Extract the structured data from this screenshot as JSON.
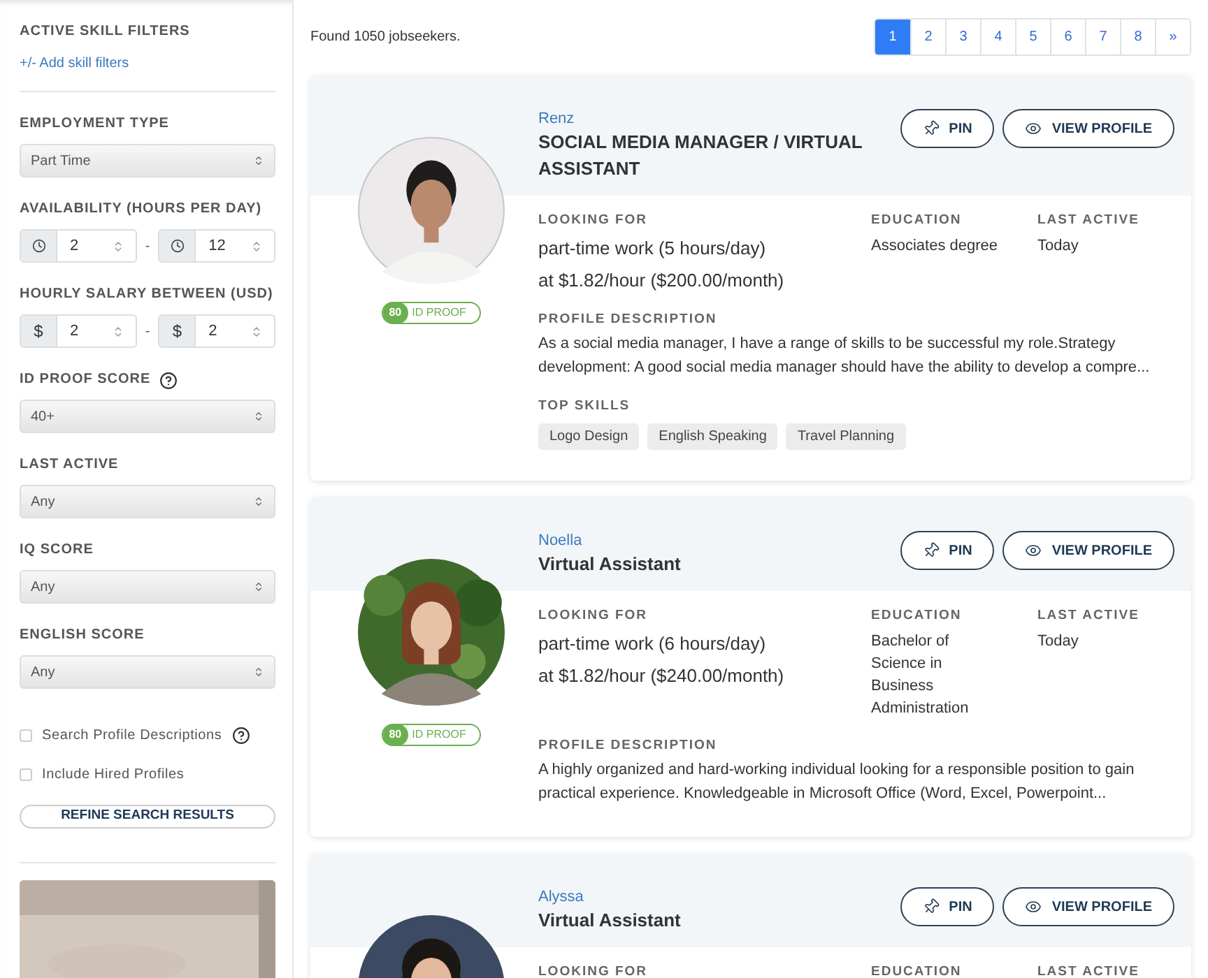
{
  "sidebar": {
    "skill_filters": {
      "heading": "ACTIVE SKILL FILTERS",
      "link": "+/- Add skill filters"
    },
    "filters": [
      {
        "kind": "select",
        "label": "EMPLOYMENT TYPE",
        "value": "Part Time",
        "help": false
      },
      {
        "kind": "time_range",
        "label": "AVAILABILITY (HOURS PER DAY)",
        "from": "2",
        "to": "12",
        "separator": "-"
      },
      {
        "kind": "money_range",
        "label": "HOURLY SALARY BETWEEN (USD)",
        "currency": "$",
        "from": "2",
        "to": "2",
        "separator": "-"
      },
      {
        "kind": "select",
        "label": "ID PROOF SCORE",
        "value": "40+",
        "help": true
      },
      {
        "kind": "select",
        "label": "LAST ACTIVE",
        "value": "Any",
        "help": false
      },
      {
        "kind": "select",
        "label": "IQ SCORE",
        "value": "Any",
        "help": false
      },
      {
        "kind": "select",
        "label": "ENGLISH SCORE",
        "value": "Any",
        "help": false
      }
    ],
    "options": [
      {
        "label": "Search Profile Descriptions",
        "checked": false,
        "help": true
      },
      {
        "label": "Include Hired Profiles",
        "checked": false,
        "help": false
      }
    ],
    "button": "REFINE SEARCH RESULTS",
    "ad_image": {
      "kind": "picture"
    }
  },
  "results": {
    "count_text": "Found 1050 jobseekers.",
    "pagination": [
      {
        "label": "1",
        "selected": true
      },
      {
        "label": "2",
        "selected": false
      },
      {
        "label": "3",
        "selected": false
      },
      {
        "label": "4",
        "selected": false
      },
      {
        "label": "5",
        "selected": false
      },
      {
        "label": "6",
        "selected": false
      },
      {
        "label": "7",
        "selected": false
      },
      {
        "label": "8",
        "selected": false
      },
      {
        "label": "»",
        "selected": false
      }
    ],
    "candidates": [
      {
        "name": "Renz",
        "title": "SOCIAL MEDIA MANAGER / VIRTUAL ASSISTANT",
        "photo": {
          "kind": "picture"
        },
        "id_proof": {
          "score": "80",
          "label": "ID PROOF"
        },
        "actions": [
          {
            "kind": "pin",
            "label": "PIN"
          },
          {
            "kind": "view",
            "label": "VIEW PROFILE"
          }
        ],
        "details": [
          {
            "label": "LOOKING FOR",
            "lines": [
              "part-time work (5 hours/day)",
              "at $1.82/hour ($200.00/month)"
            ]
          },
          {
            "label": "EDUCATION",
            "lines": [
              "Associates degree"
            ]
          },
          {
            "label": "LAST ACTIVE",
            "lines": [
              "Today"
            ]
          }
        ],
        "description": {
          "label": "PROFILE DESCRIPTION",
          "text": "As a social media manager, I have a range of skills to be successful my role.Strategy development: A good social media manager should have the ability to develop a compre..."
        },
        "skills": {
          "label": "TOP SKILLS",
          "items": [
            "Logo Design",
            "English Speaking",
            "Travel Planning"
          ]
        }
      },
      {
        "name": "Noella",
        "title": "Virtual Assistant",
        "photo": {
          "kind": "picture"
        },
        "id_proof": {
          "score": "80",
          "label": "ID PROOF"
        },
        "actions": [
          {
            "kind": "pin",
            "label": "PIN"
          },
          {
            "kind": "view",
            "label": "VIEW PROFILE"
          }
        ],
        "details": [
          {
            "label": "LOOKING FOR",
            "lines": [
              "part-time work (6 hours/day)",
              "at $1.82/hour ($240.00/month)"
            ]
          },
          {
            "label": "EDUCATION",
            "lines": [
              "Bachelor of Science in Business Administration"
            ]
          },
          {
            "label": "LAST ACTIVE",
            "lines": [
              "Today"
            ]
          }
        ],
        "description": {
          "label": "PROFILE DESCRIPTION",
          "text": "A highly organized and hard-working individual looking for a responsible position to gain practical experience. Knowledgeable in Microsoft Office (Word, Excel, Powerpoint..."
        }
      },
      {
        "name": "Alyssa",
        "title": "Virtual Assistant",
        "photo": {
          "kind": "picture"
        },
        "actions": [
          {
            "kind": "pin",
            "label": "PIN"
          },
          {
            "kind": "view",
            "label": "VIEW PROFILE"
          }
        ],
        "details": [
          {
            "label": "LOOKING FOR"
          },
          {
            "label": "EDUCATION"
          },
          {
            "label": "LAST ACTIVE"
          }
        ]
      }
    ]
  }
}
